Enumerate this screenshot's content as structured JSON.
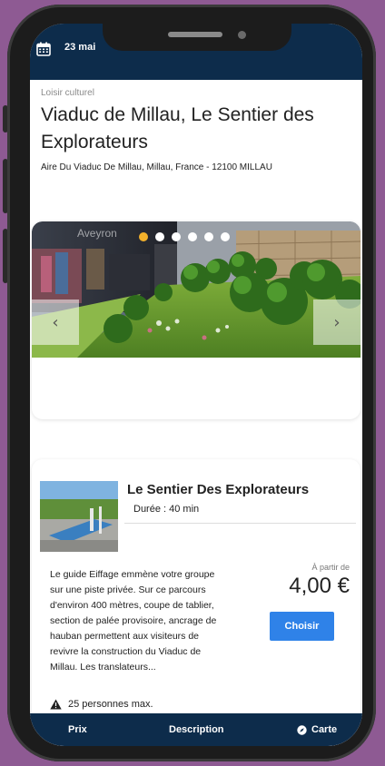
{
  "header": {
    "date": "23 mai"
  },
  "activity": {
    "category": "Loisir culturel",
    "title": "Viaduc de Millau, Le Sentier des Explorateurs",
    "address": "Aire Du Viaduc De Millau, Millau, France - 12100 MILLAU"
  },
  "gallery": {
    "watermark": "Aveyron",
    "dot_count": 6,
    "active_dot": 1
  },
  "product": {
    "title": "Le Sentier Des Explorateurs",
    "duration": "Durée : 40 min",
    "description": "Le guide Eiffage emmène votre groupe sur une piste privée. Sur ce parcours d'environ 400 mètres, coupe de tablier, section de palée provisoire, ancrage de hauban permettent aux visiteurs de revivre la construction du Viaduc de Millau. Les translateurs...",
    "price_prefix": "À partir de",
    "price": "4,00 €",
    "choose_label": "Choisir",
    "capacity": "25 personnes max."
  },
  "bottom_nav": {
    "prix": "Prix",
    "description": "Description",
    "carte": "Carte"
  },
  "colors": {
    "navy": "#0d2c4b",
    "button_blue": "#2f82e8",
    "active_dot": "#f3b12b"
  }
}
